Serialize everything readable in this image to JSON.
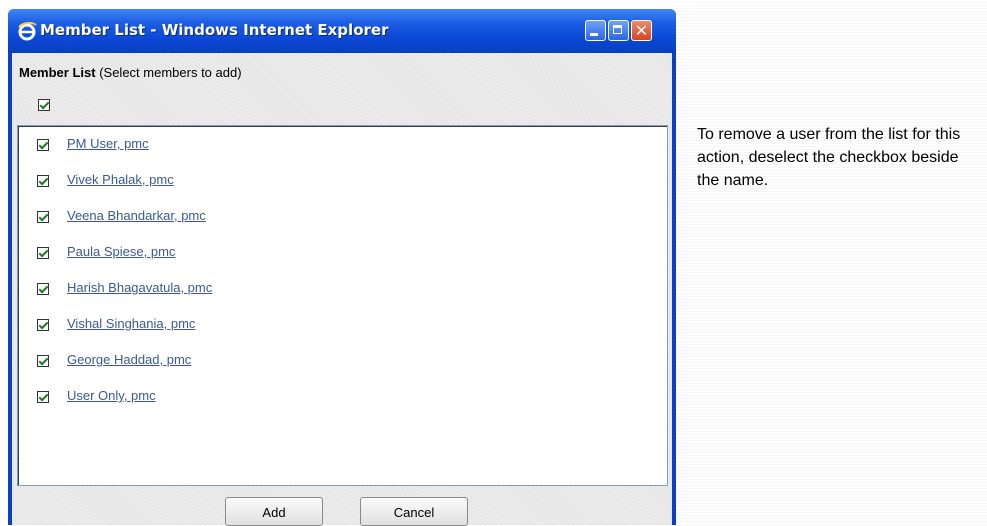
{
  "window": {
    "title": "Member List - Windows Internet Explorer",
    "close_glyph": "✕"
  },
  "header": {
    "title": "Member List",
    "subtitle": "(Select members to add)",
    "select_all_checked": true
  },
  "members": [
    {
      "label": "PM User, pmc",
      "checked": true
    },
    {
      "label": "Vivek Phalak, pmc",
      "checked": true
    },
    {
      "label": "Veena Bhandarkar, pmc",
      "checked": true
    },
    {
      "label": "Paula Spiese, pmc",
      "checked": true
    },
    {
      "label": "Harish Bhagavatula, pmc",
      "checked": true
    },
    {
      "label": "Vishal Singhania, pmc",
      "checked": true
    },
    {
      "label": "George Haddad, pmc",
      "checked": true
    },
    {
      "label": "User Only, pmc",
      "checked": true
    }
  ],
  "buttons": {
    "add_label": "Add",
    "cancel_label": "Cancel"
  },
  "instructions": "To remove a user from the list for this action, deselect the checkbox beside the name.",
  "colors": {
    "titlebar": "#0b47d4",
    "link": "#3b5998",
    "checkmark": "#1f7a1f"
  },
  "icons": [
    "ie-icon",
    "minimize-icon",
    "maximize-icon",
    "close-icon",
    "checkbox-checked-icon"
  ]
}
